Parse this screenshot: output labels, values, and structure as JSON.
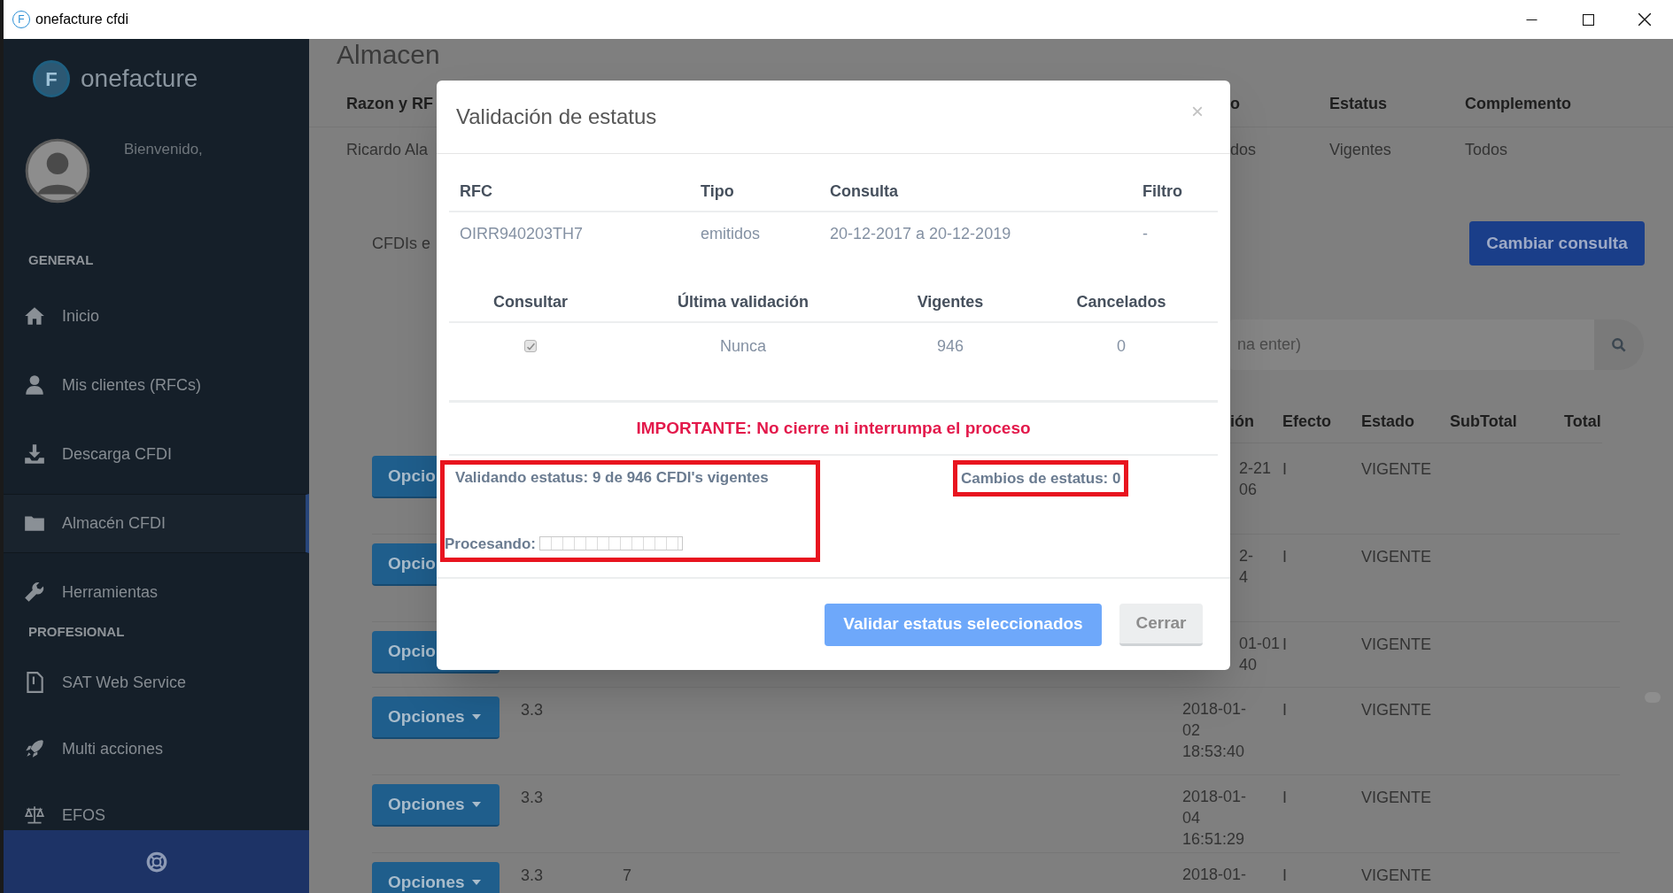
{
  "window": {
    "icon_letter": "F",
    "title": "onefacture cfdi"
  },
  "sidebar": {
    "logo_letter": "F",
    "brand": "onefacture",
    "greeting": "Bienvenido,",
    "sections": [
      {
        "title": "GENERAL",
        "items": [
          {
            "label": "Inicio",
            "selected": false
          },
          {
            "label": "Mis clientes (RFCs)",
            "selected": false
          },
          {
            "label": "Descarga CFDI",
            "selected": false
          },
          {
            "label": "Almacén CFDI",
            "selected": true
          },
          {
            "label": "Herramientas",
            "selected": false
          }
        ]
      },
      {
        "title": "PROFESIONAL",
        "items": [
          {
            "label": "SAT Web Service",
            "selected": false
          },
          {
            "label": "Multi acciones",
            "selected": false
          },
          {
            "label": "EFOS",
            "selected": false
          }
        ]
      }
    ]
  },
  "page": {
    "heading": "Almacen",
    "query_table": {
      "columns": [
        "Razon y RF",
        "o",
        "Estatus",
        "Complemento"
      ],
      "row": [
        "Ricardo Ala",
        "dos",
        "Vigentes",
        "Todos"
      ]
    },
    "panel_label": "CFDIs e",
    "change_button": "Cambiar consulta",
    "search": {
      "value": "na enter)"
    },
    "results": {
      "columns": [
        "ión",
        "Efecto",
        "Estado",
        "SubTotal",
        "Total"
      ],
      "rows": [
        {
          "button": "Opcio",
          "date_lines": [
            "2-21",
            "06"
          ],
          "effect": "I",
          "state": "VIGENTE"
        },
        {
          "button": "Opcio",
          "date_lines": [
            "2-",
            "4"
          ],
          "effect": "I",
          "state": "VIGENTE"
        },
        {
          "button": "Opcio",
          "date_lines": [
            "01-01",
            "40"
          ],
          "effect": "I",
          "state": "VIGENTE"
        },
        {
          "button": "Opciones",
          "version": "3.3",
          "date_lines": [
            "2018-01-",
            "02",
            "18:53:40"
          ],
          "effect": "I",
          "state": "VIGENTE"
        },
        {
          "button": "Opciones",
          "version": "3.3",
          "date_lines": [
            "2018-01-",
            "04",
            "16:51:29"
          ],
          "effect": "I",
          "state": "VIGENTE"
        },
        {
          "button": "Opciones",
          "version": "3.3",
          "note": "7",
          "date_lines": [
            "2018-01-"
          ],
          "effect": "I",
          "state": "VIGENTE"
        }
      ]
    }
  },
  "modal": {
    "title": "Validación de estatus",
    "close": "×",
    "summary": {
      "columns": [
        "RFC",
        "Tipo",
        "Consulta",
        "Filtro"
      ],
      "row": [
        "OIRR940203TH7",
        "emitidos",
        "20-12-2017 a 20-12-2019",
        "-"
      ]
    },
    "validation": {
      "columns": [
        "Consultar",
        "Última validación",
        "Vigentes",
        "Cancelados"
      ],
      "row": {
        "checked": true,
        "disabled": true,
        "last": "Nunca",
        "valid": "946",
        "cancelled": "0"
      }
    },
    "warning": "IMPORTANTE: No cierre ni interrumpa el proceso",
    "progress_text": "Validando estatus: 9 de 946 CFDI's vigentes",
    "processing_label": "Procesando:",
    "progress": {
      "level": 0
    },
    "changes_text": "Cambios de estatus: 0",
    "buttons": [
      {
        "label": "Validar estatus seleccionados",
        "kind": "primary"
      },
      {
        "label": "Cerrar",
        "kind": "secondary"
      }
    ]
  }
}
